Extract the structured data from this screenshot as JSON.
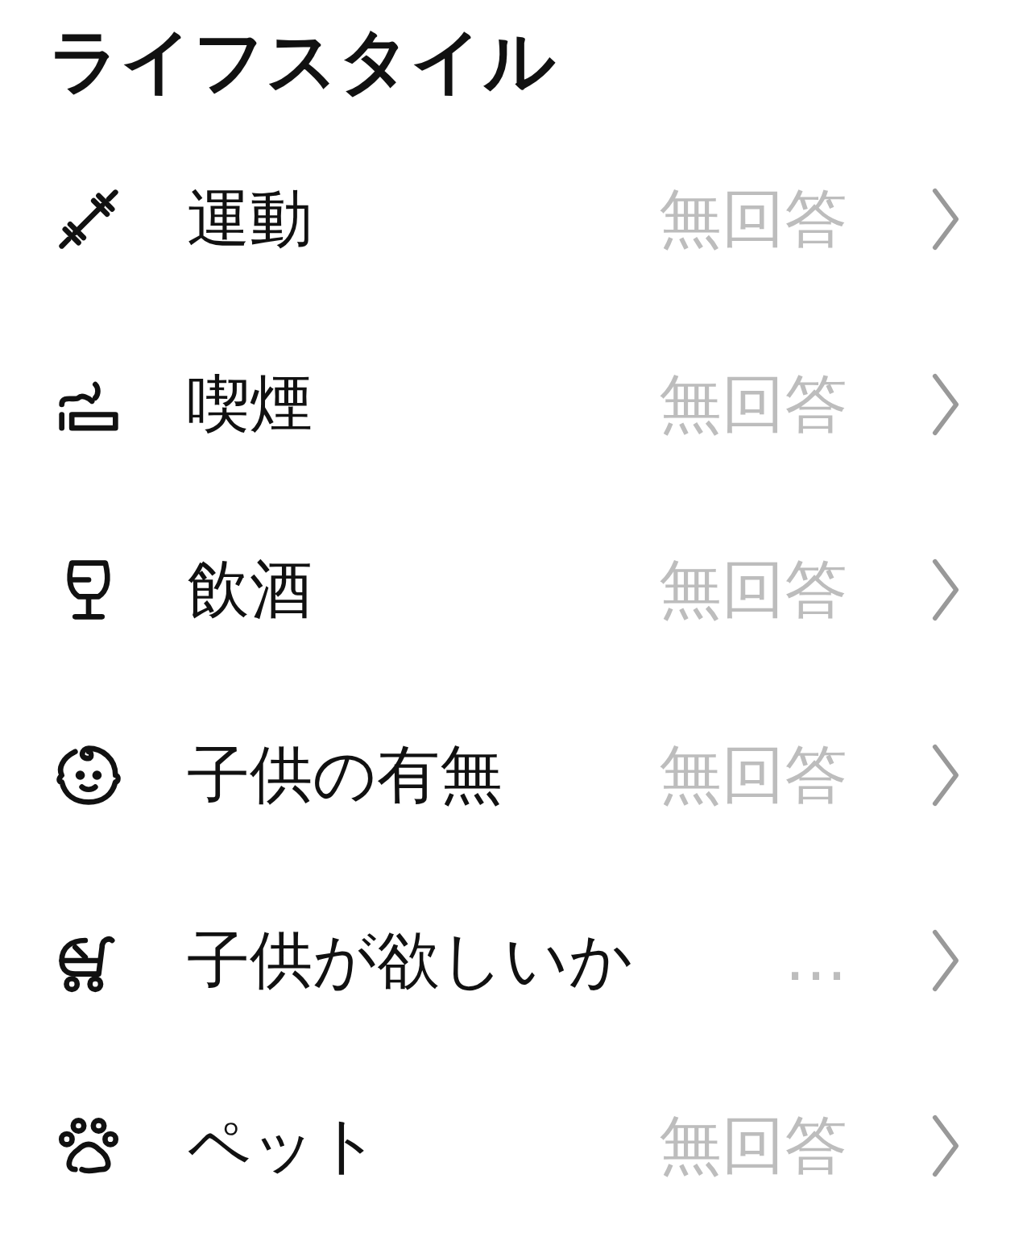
{
  "title": "ライフスタイル",
  "items": [
    {
      "kind": "exercise",
      "label": "運動",
      "value": "無回答"
    },
    {
      "kind": "smoking",
      "label": "喫煙",
      "value": "無回答"
    },
    {
      "kind": "drinking",
      "label": "飲酒",
      "value": "無回答"
    },
    {
      "kind": "children",
      "label": "子供の有無",
      "value": "無回答"
    },
    {
      "kind": "want_children",
      "label": "子供が欲しいか",
      "value": "…"
    },
    {
      "kind": "pet",
      "label": "ペット",
      "value": "無回答"
    }
  ]
}
